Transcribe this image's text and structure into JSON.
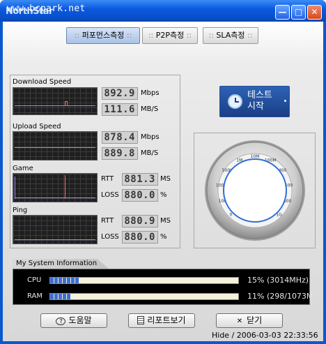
{
  "window": {
    "logo_text": "NorthStar",
    "url_text": "www.bcpark.net",
    "minimize_glyph": "—",
    "maximize_glyph": "□",
    "close_glyph": "✕"
  },
  "tabs": [
    {
      "label": "퍼포먼스측정",
      "active": true
    },
    {
      "label": "P2P측정",
      "active": false
    },
    {
      "label": "SLA측정",
      "active": false
    }
  ],
  "tab_dots": "::",
  "download": {
    "label": "Download Speed",
    "mbps_value": "892.9",
    "mbps_unit": "Mbps",
    "mbs_value": "111.6",
    "mbs_unit": "MB/S"
  },
  "upload": {
    "label": "Upload Speed",
    "mbps_value": "878.4",
    "mbps_unit": "Mbps",
    "mbs_value": "889.8",
    "mbs_unit": "MB/S"
  },
  "game": {
    "label": "Game",
    "rtt_label": "RTT",
    "rtt_value": "881.3",
    "rtt_unit": "MS",
    "loss_label": "LOSS",
    "loss_value": "880.0",
    "loss_unit": "%"
  },
  "ping": {
    "label": "Ping",
    "rtt_label": "RTT",
    "rtt_value": "880.9",
    "rtt_unit": "MS",
    "loss_label": "LOSS",
    "loss_value": "880.0",
    "loss_unit": "%"
  },
  "test_button": {
    "line1": "테스트",
    "line2": "시작"
  },
  "gauge": {
    "ticks": [
      "0",
      "10K",
      "100K",
      "500K",
      "1M",
      "10M",
      "100M",
      "400",
      "500",
      "600",
      "1G"
    ]
  },
  "system_info": {
    "title": "My System Information",
    "cpu": {
      "label": "CPU",
      "fraction": 0.15,
      "value": "15% (3014MHz)"
    },
    "ram": {
      "label": "RAM",
      "fraction": 0.11,
      "value": "11% (298/1073M"
    }
  },
  "buttons": {
    "help": "도움말",
    "report": "리포트보기",
    "close": "닫기"
  },
  "status": "Hide / 2006-03-03 22:33:56",
  "colors": {
    "title_blue": "#0b5ae0",
    "graph_line": "#9c8cff",
    "game_spike": "#ff6d6d",
    "bar_fill": "#3c6fd0"
  }
}
